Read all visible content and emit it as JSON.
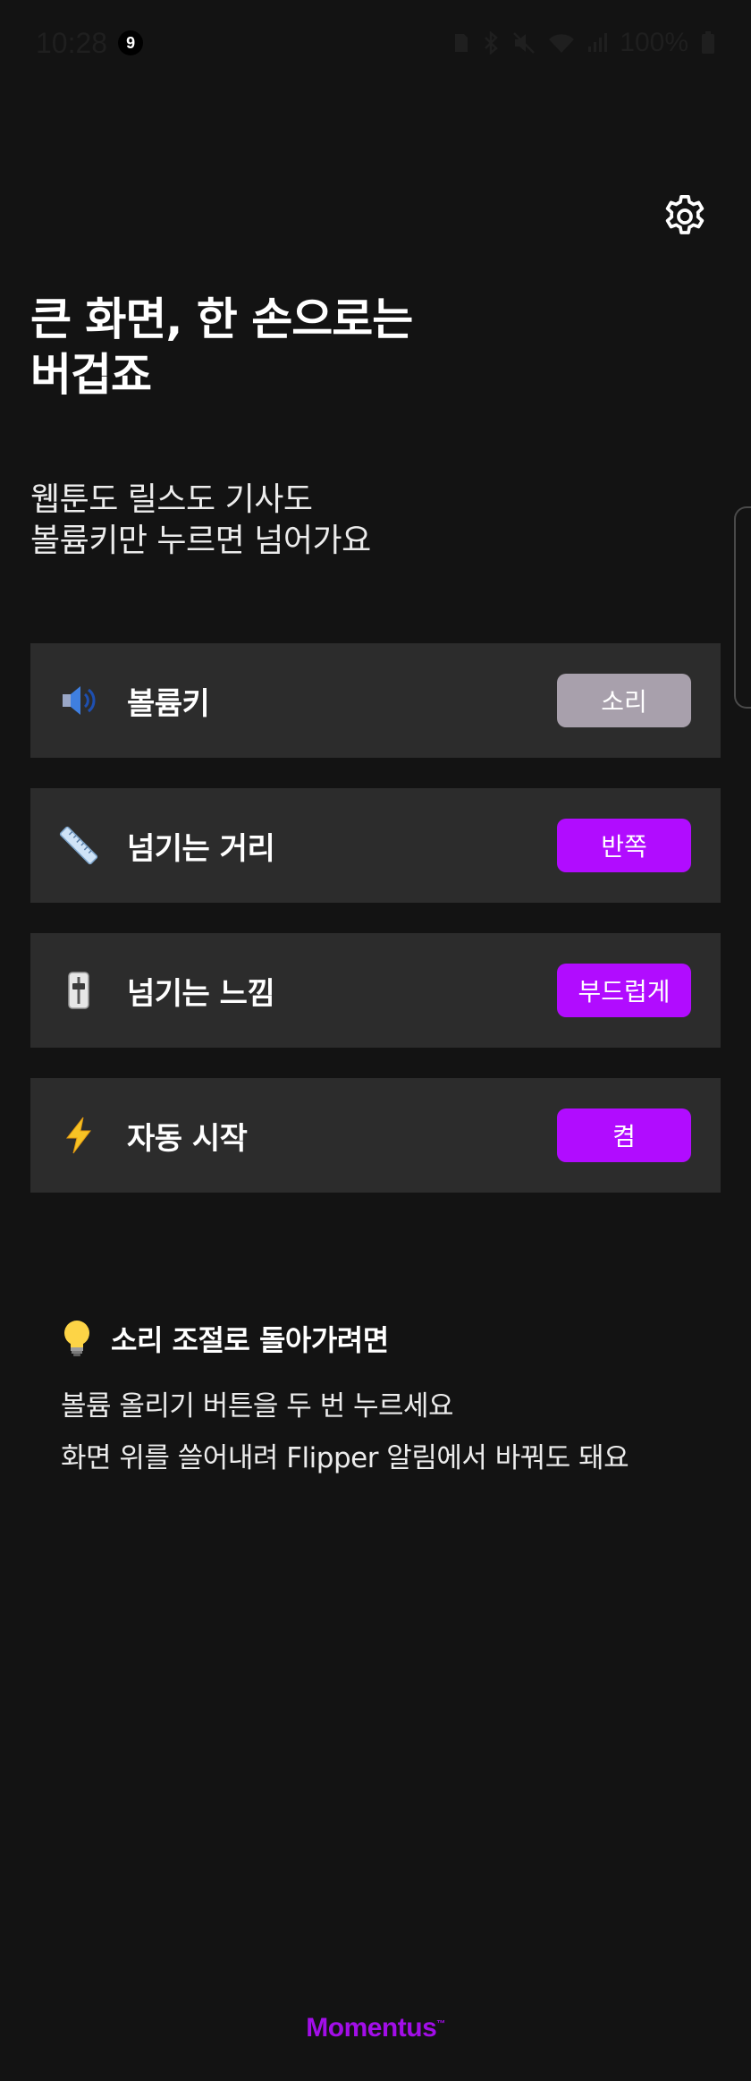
{
  "status_bar": {
    "time": "10:28",
    "notification_count": "9",
    "battery": "100%"
  },
  "settings": {
    "icon": "gear-icon"
  },
  "headline": {
    "line1": "큰 화면, 한 손으로는",
    "line2": "버겁죠"
  },
  "subhead": {
    "line1": "웹툰도 릴스도 기사도",
    "line2": "볼륨키만 누르면 넘어가요"
  },
  "options": [
    {
      "icon": "speaker-icon",
      "label": "볼륨키",
      "value": "소리",
      "state": "inactive"
    },
    {
      "icon": "ruler-icon",
      "label": "넘기는 거리",
      "value": "반쪽",
      "state": "active"
    },
    {
      "icon": "slider-icon",
      "label": "넘기는 느낌",
      "value": "부드럽게",
      "state": "active"
    },
    {
      "icon": "lightning-icon",
      "label": "자동 시작",
      "value": "켬",
      "state": "active"
    }
  ],
  "tip": {
    "icon": "lightbulb-icon",
    "title": "소리 조절로 돌아가려면",
    "line1": "볼륨 올리기 버튼을 두 번 누르세요",
    "line2": "화면 위를 쓸어내려 Flipper 알림에서 바꿔도 돼요"
  },
  "brand": {
    "name": "Momentus",
    "mark": "™"
  },
  "colors": {
    "background": "#131313",
    "card": "#2c2c2c",
    "accent": "#b10cff",
    "inactive_button": "#a8a0ac",
    "brand": "#a20ee8"
  }
}
